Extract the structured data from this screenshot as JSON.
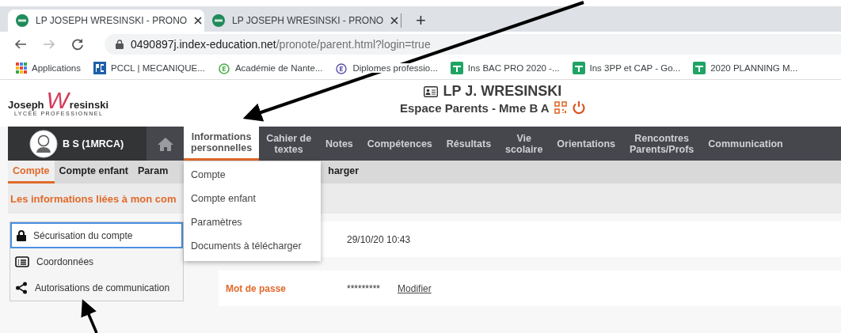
{
  "browser": {
    "tabs": [
      {
        "title": "LP JOSEPH WRESINSKI - PRONO",
        "selected": true
      },
      {
        "title": "LP JOSEPH WRESINSKI - PRONO",
        "selected": false
      }
    ],
    "new_tab": "+",
    "address": {
      "domain": "0490897j.index-education.net",
      "path": "/pronote/parent.html?login=true"
    },
    "bookmarks": [
      {
        "label": "Applications",
        "kind": "apps"
      },
      {
        "label": "PCCL | MECANIQUE...",
        "kind": "pc"
      },
      {
        "label": "Académie de Nante...",
        "kind": "academie"
      },
      {
        "label": "Diplomes professio...",
        "kind": "diplomes"
      },
      {
        "label": "Ins BAC PRO 2020 -...",
        "kind": "sheet"
      },
      {
        "label": "Ins 3PP et CAP - Go...",
        "kind": "sheet"
      },
      {
        "label": "2020 PLANNING M...",
        "kind": "sheet"
      }
    ]
  },
  "header": {
    "logo": {
      "first": "Joseph",
      "initial": "W",
      "rest": "resinski",
      "tagline": "LYCÉE PROFESSIONNEL"
    },
    "title": "LP J. WRESINSKI",
    "subtitle": "Espace Parents - Mme B A"
  },
  "nav": {
    "user": "B S (1MRCA)",
    "items": [
      {
        "kind": "home",
        "selected": false
      },
      {
        "label": "Informations personnelles",
        "selected": true
      },
      {
        "label": "Cahier de textes",
        "selected": false
      },
      {
        "label": "Notes",
        "selected": false
      },
      {
        "label": "Compétences",
        "selected": false
      },
      {
        "label": "Résultats",
        "selected": false
      },
      {
        "label": "Vie scolaire",
        "selected": false
      },
      {
        "label": "Orientations",
        "selected": false
      },
      {
        "label": "Rencontres Parents/Profs",
        "selected": false
      },
      {
        "label": "Communication",
        "selected": false
      }
    ]
  },
  "sub_tabs": [
    {
      "label": "Compte",
      "selected": true
    },
    {
      "label": "Compte enfant",
      "selected": false
    },
    {
      "label": "Param",
      "selected": false
    },
    {
      "label": "harger",
      "selected": false
    }
  ],
  "dropdown": [
    "Compte",
    "Compte enfant",
    "Paramètres",
    "Documents à télécharger"
  ],
  "section_title": "Les informations liées à mon com",
  "side_menu": [
    {
      "label": "Sécurisation du compte",
      "kind": "lock",
      "selected": true
    },
    {
      "label": "Coordonnées",
      "kind": "list",
      "selected": false
    },
    {
      "label": "Autorisations de communication",
      "kind": "share",
      "selected": false
    }
  ],
  "details": [
    {
      "value": "29/10/20 10:43"
    },
    {
      "label": "Mot de passe",
      "value": "*********",
      "link": "Modifier"
    }
  ]
}
